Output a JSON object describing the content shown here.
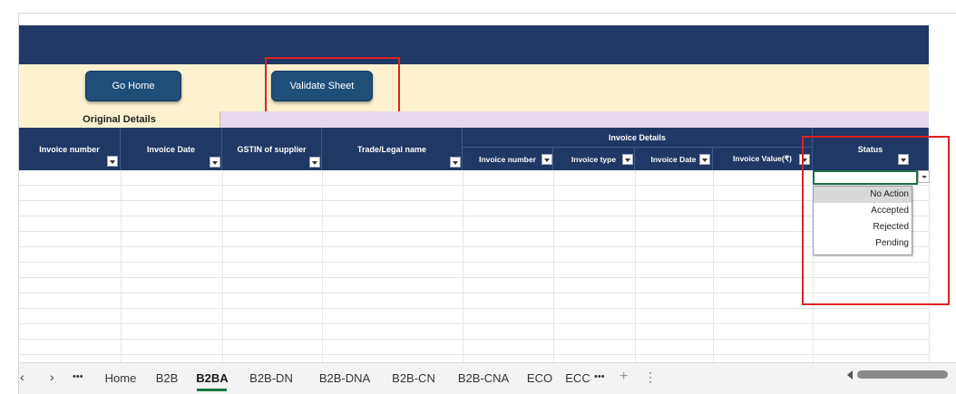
{
  "buttons": {
    "go_home": "Go Home",
    "validate_sheet": "Validate Sheet"
  },
  "section_header": "Original Details",
  "columns": {
    "invoice_number": "Invoice number",
    "invoice_date": "Invoice Date",
    "gstin": "GSTIN of supplier",
    "trade_name": "Trade/Legal name",
    "invoice_details_group": "Invoice Details",
    "sub_invoice_number": "Invoice number",
    "sub_invoice_type": "Invoice type",
    "sub_invoice_date": "Invoice Date",
    "sub_invoice_value": "Invoice Value(₹)",
    "status": "Status"
  },
  "status_dropdown": {
    "options": [
      "No Action",
      "Accepted",
      "Rejected",
      "Pending"
    ],
    "highlighted": "No Action"
  },
  "sheet_tabs": {
    "more": "•••",
    "items": [
      "Home",
      "B2B",
      "B2BA",
      "B2B-DN",
      "B2B-DNA",
      "B2B-CN",
      "B2B-CNA",
      "ECO",
      "ECC"
    ],
    "active": "B2BA",
    "add": "+",
    "options": "⋮"
  },
  "colors": {
    "navy": "#1f3864",
    "cream": "#fdf1cf",
    "purple": "#e6d9ec",
    "button": "#1f4e79",
    "highlight_red": "#e02020",
    "active_tab_green": "#107c41"
  }
}
